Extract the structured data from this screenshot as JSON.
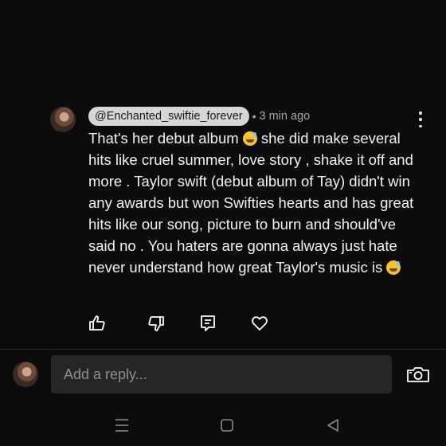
{
  "comment": {
    "author": "@Enchanted_swiftie_forever",
    "separator": "•",
    "time": "3 min ago",
    "text_part1": "That's her debut album ",
    "text_part2": " she did make several hits like cruel summer, love story , shake it off and more . Taylor swift (debut album of Tay) didn't win any awards but won Swifties hearts and has great hits like our song, picture to burn and should've said no . You haters are gonna always just hate never understand how great Taylor's music is ",
    "emoji": "sweat-smile-emoji"
  },
  "actions": [
    "thumbs-up-icon",
    "thumbs-down-icon",
    "reply-icon",
    "heart-icon"
  ],
  "reply_box": {
    "placeholder": "Add a reply..."
  },
  "nav": [
    "recent-apps-icon",
    "home-icon",
    "back-icon"
  ],
  "colors": {
    "background": "#0c0c0c",
    "handle_bg": "#d7d7d7",
    "input_bg": "#262626",
    "meta_text": "#a8a8a8"
  }
}
